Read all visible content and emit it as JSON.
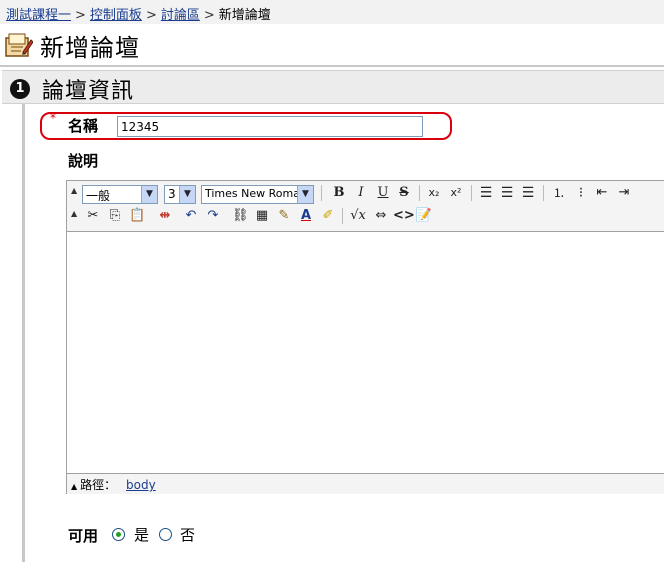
{
  "breadcrumb": {
    "items": [
      "測試課程一",
      "控制面板",
      "討論區"
    ],
    "current": "新增論壇",
    "separator": ">"
  },
  "page": {
    "title": "新增論壇",
    "icon": "forum-edit-icon"
  },
  "section": {
    "number": "❶",
    "title": "論壇資訊"
  },
  "form": {
    "required_mark": "*",
    "name_label": "名稱",
    "name_value": "12345",
    "description_label": "說明",
    "available_label": "可用",
    "available_options": [
      "是",
      "否"
    ],
    "available_selected": "是"
  },
  "editor": {
    "format_select": "一般",
    "size_select": "3",
    "font_select": "Times New Roman",
    "toolbar_row1": [
      "B",
      "I",
      "U",
      "S",
      "x₂",
      "x²",
      "align-left",
      "align-center",
      "align-right",
      "ordered-list",
      "unordered-list",
      "outdent",
      "indent"
    ],
    "toolbar_row2": [
      "cut",
      "copy",
      "paste",
      "special-char",
      "undo",
      "redo",
      "link",
      "table",
      "pencil",
      "font-color",
      "highlight",
      "equation",
      "anchor",
      "source",
      "spellcheck"
    ],
    "path_label": "路徑：",
    "path_value": "body"
  },
  "colors": {
    "highlight": "#d8000c",
    "link": "#1a3d8f",
    "radio_dot": "#21a121"
  }
}
